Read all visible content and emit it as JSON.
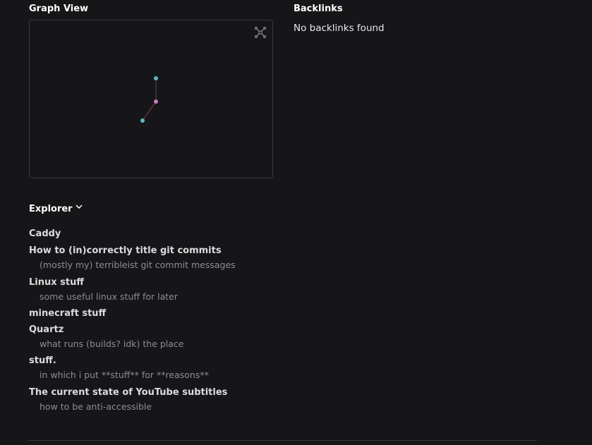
{
  "graph": {
    "title": "Graph View",
    "global_graph_icon": "graph-network-icon"
  },
  "backlinks": {
    "title": "Backlinks",
    "empty_text": "No backlinks found"
  },
  "explorer": {
    "title": "Explorer",
    "toggle_icon": "chevron-down-icon",
    "items": [
      {
        "title": "Caddy",
        "description": ""
      },
      {
        "title": "How to (in)correctly title git commits",
        "description": "(mostly my) terribleist git commit messages"
      },
      {
        "title": "Linux stuff",
        "description": "some useful linux stuff for later"
      },
      {
        "title": "minecraft stuff",
        "description": ""
      },
      {
        "title": "Quartz",
        "description": "what runs (builds? idk) the place"
      },
      {
        "title": "stuff.",
        "description": "in which i put **stuff** for **reasons**"
      },
      {
        "title": "The current state of YouTube subtitles",
        "description": "how to be anti-accessible"
      }
    ]
  },
  "colors": {
    "background": "#161618",
    "node_teal": "#5fb8c4",
    "node_current": "#c77dc6",
    "edge_top": "#4a4a4e",
    "edge_bottom": "#8a3a52"
  }
}
